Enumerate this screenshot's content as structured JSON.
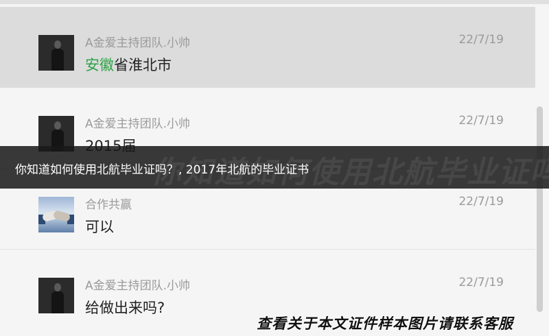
{
  "conversations": [
    {
      "sender": "A金爱主持团队.小帅",
      "date": "22/7/19",
      "message_highlight": "安徽",
      "message": "省淮北市",
      "selected": true,
      "avatar": "person-avatar"
    },
    {
      "sender": "A金爱主持团队.小帅",
      "date": "22/7/19",
      "message_highlight": "",
      "message": "2015届",
      "selected": false,
      "avatar": "person-avatar"
    },
    {
      "sender": "合作共赢",
      "date": "22/7/19",
      "message_highlight": "",
      "message": "可以",
      "selected": false,
      "avatar": "handshake-avatar"
    },
    {
      "sender": "A金爱主持团队.小帅",
      "date": "22/7/19",
      "message_highlight": "",
      "message": "给做出来吗?",
      "selected": false,
      "avatar": "person-avatar"
    }
  ],
  "banner": {
    "headline": "你知道如何使用北航毕业证吗？, 2017年北航的毕业证书",
    "background_text": "你知道如何使用北航毕业证吗？"
  },
  "watermark": "查看关于本文证件样本图片请联系客服",
  "colors": {
    "highlight_green": "#2ba245",
    "selected_row": "#dcdcdc",
    "list_background": "#f5f5f5"
  }
}
